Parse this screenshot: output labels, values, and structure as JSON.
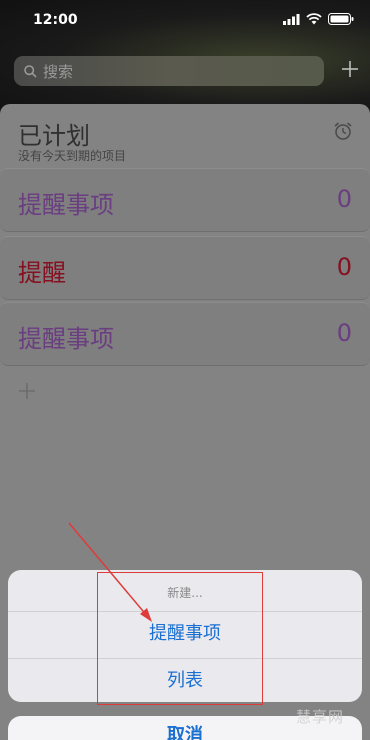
{
  "status_bar": {
    "time": "12:00"
  },
  "search": {
    "placeholder": "搜索"
  },
  "scheduled": {
    "title": "已计划",
    "subtitle": "没有今天到期的项目"
  },
  "lists": [
    {
      "label": "提醒事项",
      "count": "0",
      "color": "#6a3e80"
    },
    {
      "label": "提醒",
      "count": "0",
      "color": "#86101f"
    },
    {
      "label": "提醒事项",
      "count": "0",
      "color": "#6a3e80"
    }
  ],
  "action_sheet": {
    "title": "新建...",
    "options": [
      "提醒事项",
      "列表"
    ],
    "cancel": "取消"
  },
  "watermark": "慧享网",
  "colors": {
    "accent": "#1a6fd0",
    "annotation": "#e03b3b"
  }
}
